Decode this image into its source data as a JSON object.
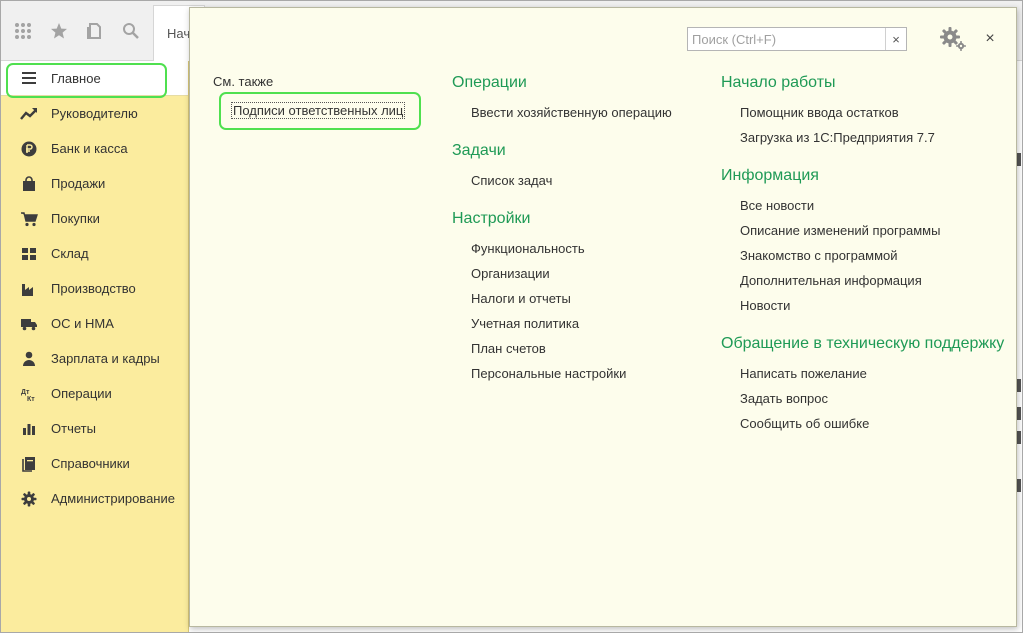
{
  "toolbar": {
    "icons": [
      "apps-grid-icon",
      "star-icon",
      "history-icon",
      "search-icon"
    ],
    "tab_label": "Нач"
  },
  "sidebar": {
    "items": [
      {
        "label": "Главное",
        "icon": "menu-lines-icon",
        "active": true
      },
      {
        "label": "Руководителю",
        "icon": "trend-icon"
      },
      {
        "label": "Банк и касса",
        "icon": "ruble-coin-icon"
      },
      {
        "label": "Продажи",
        "icon": "shopping-bag-icon"
      },
      {
        "label": "Покупки",
        "icon": "cart-icon"
      },
      {
        "label": "Склад",
        "icon": "warehouse-icon"
      },
      {
        "label": "Производство",
        "icon": "factory-icon"
      },
      {
        "label": "ОС и НМА",
        "icon": "truck-icon"
      },
      {
        "label": "Зарплата и кадры",
        "icon": "person-icon"
      },
      {
        "label": "Операции",
        "icon": "dt-kt-icon"
      },
      {
        "label": "Отчеты",
        "icon": "bar-chart-icon"
      },
      {
        "label": "Справочники",
        "icon": "book-icon"
      },
      {
        "label": "Администрирование",
        "icon": "gear-icon"
      }
    ]
  },
  "popup": {
    "search_placeholder": "Поиск (Ctrl+F)",
    "search_value": "",
    "clear_symbol": "×",
    "close_symbol": "×",
    "see_also": {
      "label": "См. также",
      "link": "Подписи ответственных лиц"
    },
    "columns": [
      [
        {
          "title": "Операции",
          "links": [
            "Ввести хозяйственную операцию"
          ]
        },
        {
          "title": "Задачи",
          "links": [
            "Список задач"
          ]
        },
        {
          "title": "Настройки",
          "links": [
            "Функциональность",
            "Организации",
            "Налоги и отчеты",
            "Учетная политика",
            "План счетов",
            "Персональные настройки"
          ]
        }
      ],
      [
        {
          "title": "Начало работы",
          "links": [
            "Помощник ввода остатков",
            "Загрузка из 1С:Предприятия 7.7"
          ]
        },
        {
          "title": "Информация",
          "links": [
            "Все новости",
            "Описание изменений программы",
            "Знакомство с программой",
            "Дополнительная информация",
            "Новости"
          ]
        },
        {
          "title": "Обращение в техническую поддержку",
          "links": [
            "Написать пожелание",
            "Задать вопрос",
            "Сообщить об ошибке"
          ]
        }
      ]
    ]
  },
  "colors": {
    "sidebar_bg": "#fbec9e",
    "popup_bg": "#fdfdec",
    "section_title": "#1f9a56",
    "highlight": "#4fe04f"
  }
}
